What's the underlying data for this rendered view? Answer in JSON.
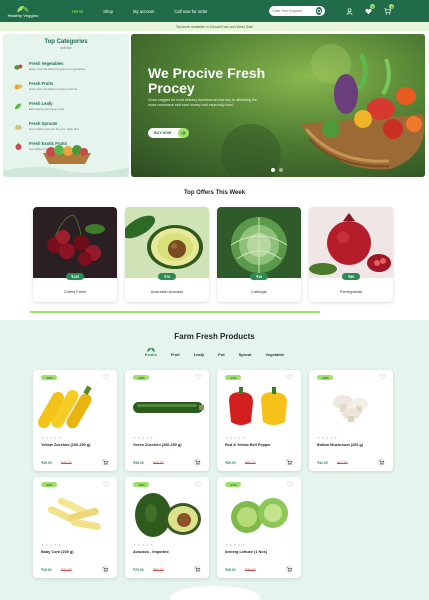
{
  "header": {
    "logo_text": "Healthy Veggies",
    "nav": [
      {
        "label": "Home",
        "active": true
      },
      {
        "label": "Shop",
        "active": false
      },
      {
        "label": "My account",
        "active": false
      },
      {
        "label": "Call now for order",
        "active": false
      }
    ],
    "search_placeholder": "Enter Your Keyword",
    "wishlist_count": "0",
    "cart_count": "0"
  },
  "notice": "Services available in Mohali East and West Side",
  "categories": {
    "title": "Top Categories",
    "subtitle": "sub title",
    "items": [
      {
        "name": "Fresh Vegetables",
        "desc": "Have over 20 different types of vegetables",
        "color": "#4a9a3a"
      },
      {
        "name": "Fresh Fruits",
        "desc": "Have over 20 different types of fruits",
        "color": "#e8a53a"
      },
      {
        "name": "Fresh Leafy",
        "desc": "Eat healthy and keep body",
        "color": "#5cb84a"
      },
      {
        "name": "Fresh Sprouts",
        "desc": "Get healthy sprouts for your daily diet",
        "color": "#d9c37a"
      },
      {
        "name": "Fresh Exotic Fruits",
        "desc": "Get different types of Exotic fruits",
        "color": "#c94a4a"
      }
    ]
  },
  "hero": {
    "title": "We Procive Fresh Procey",
    "text": "Good veggies for local delivery business are the key to attracting the more customers and earn money and especially food.",
    "button": "BUY NOW",
    "slides": 2,
    "active_slide": 1
  },
  "offers": {
    "title": "Top Offers This Week",
    "items": [
      {
        "name": "Cherry Fresh",
        "price": "₹125"
      },
      {
        "name": "Australian Avocado",
        "price": "₹70"
      },
      {
        "name": "Cabbage",
        "price": "₹19"
      },
      {
        "name": "Pomegranate",
        "price": "₹86"
      }
    ]
  },
  "farm": {
    "title": "Farm Fresh Products",
    "tabs": [
      {
        "label": "Exotic",
        "active": true
      },
      {
        "label": "Fruit",
        "active": false
      },
      {
        "label": "Leafy",
        "active": false
      },
      {
        "label": "Pot",
        "active": false
      },
      {
        "label": "Sprout",
        "active": false
      },
      {
        "label": "Vegetable",
        "active": false
      }
    ],
    "products": [
      {
        "badge": "-10%",
        "name": "Yellow Zucchini (200-250 g)",
        "price": "₹30.00",
        "old": "₹40.00"
      },
      {
        "badge": "-10%",
        "name": "Green Zucchini (200-250 g)",
        "price": "₹36.00",
        "old": "₹40.00"
      },
      {
        "badge": "-11%",
        "name": "Red & Yellow Bell Pepper",
        "price": "₹80.00",
        "old": "₹90.00"
      },
      {
        "badge": "-10%",
        "name": "Button Mushroom (200 g)",
        "price": "₹42.00",
        "old": "₹47.00"
      },
      {
        "badge": "-12%",
        "name": "Baby Corn (200 g)",
        "price": "₹19.00",
        "old": "₹22.00"
      },
      {
        "badge": "-10%",
        "name": "Avocado - Imported",
        "price": "₹70.00",
        "old": "₹80.00"
      },
      {
        "badge": "-17%",
        "name": "Iceberg Lettuce (1 Nos)",
        "price": "₹30.00",
        "old": "₹36.00"
      }
    ]
  },
  "colors": {
    "primary": "#1f6b4a",
    "accent": "#9fe067",
    "light_bg": "#e6f4ee"
  }
}
